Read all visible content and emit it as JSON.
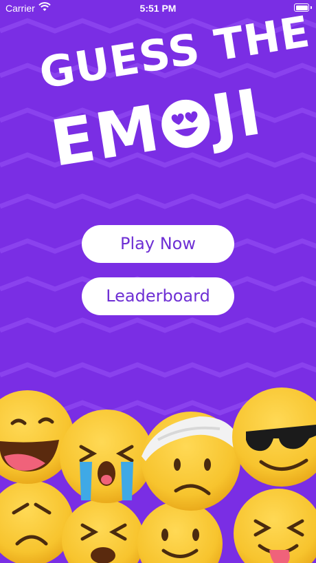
{
  "status_bar": {
    "carrier": "Carrier",
    "time": "5:51 PM"
  },
  "title": {
    "line1": "GUESS THE",
    "line2_part1": "EM",
    "line2_part2": "JI"
  },
  "buttons": {
    "play_label": "Play Now",
    "leaderboard_label": "Leaderboard"
  },
  "colors": {
    "background": "#7a2ee4",
    "button_text": "#6e2fd4",
    "emoji_yellow": "#f7c42e"
  },
  "icons": [
    "wifi-icon",
    "battery-icon",
    "heart-eyes-emoji-icon",
    "laughing-emoji-icon",
    "crying-emoji-icon",
    "bandaged-emoji-icon",
    "sunglasses-emoji-icon",
    "sad-emoji-icon",
    "smiling-emoji-icon",
    "tongue-out-emoji-icon"
  ]
}
